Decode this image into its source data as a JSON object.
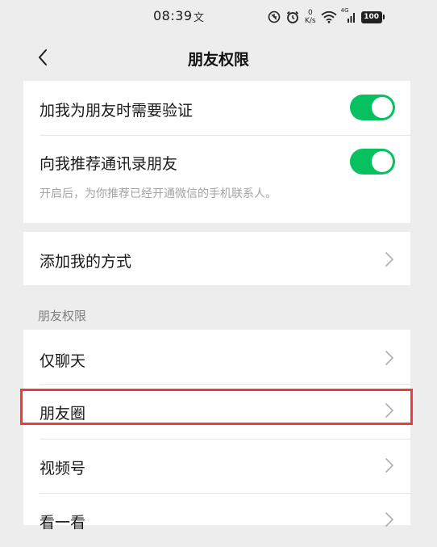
{
  "status_bar": {
    "time": "08:39",
    "aux_glyph": "文",
    "net_speed_value": "0",
    "net_speed_unit": "K/s",
    "network_type": "4G",
    "battery": "100",
    "icons": [
      "do-not-disturb-icon",
      "alarm-icon",
      "net-speed-icon",
      "wifi-icon",
      "signal-icon",
      "battery-icon"
    ]
  },
  "nav": {
    "back_icon": "chevron-left-icon",
    "title": "朋友权限"
  },
  "verification": {
    "add_requires_verification": {
      "label": "加我为朋友时需要验证",
      "enabled": true
    },
    "recommend_contacts": {
      "label": "向我推荐通讯录朋友",
      "enabled": true
    },
    "hint": "开启后，为你推荐已经开通微信的手机联系人。"
  },
  "add_methods": {
    "label": "添加我的方式"
  },
  "friend_permissions": {
    "header": "朋友权限",
    "items": [
      {
        "label": "仅聊天"
      },
      {
        "label": "朋友圈"
      },
      {
        "label": "视频号"
      },
      {
        "label": "看一看"
      }
    ]
  },
  "colors": {
    "toggle_on": "#07c160",
    "highlight_border": "#ee3b3b",
    "background": "#ededed",
    "card": "#ffffff"
  }
}
